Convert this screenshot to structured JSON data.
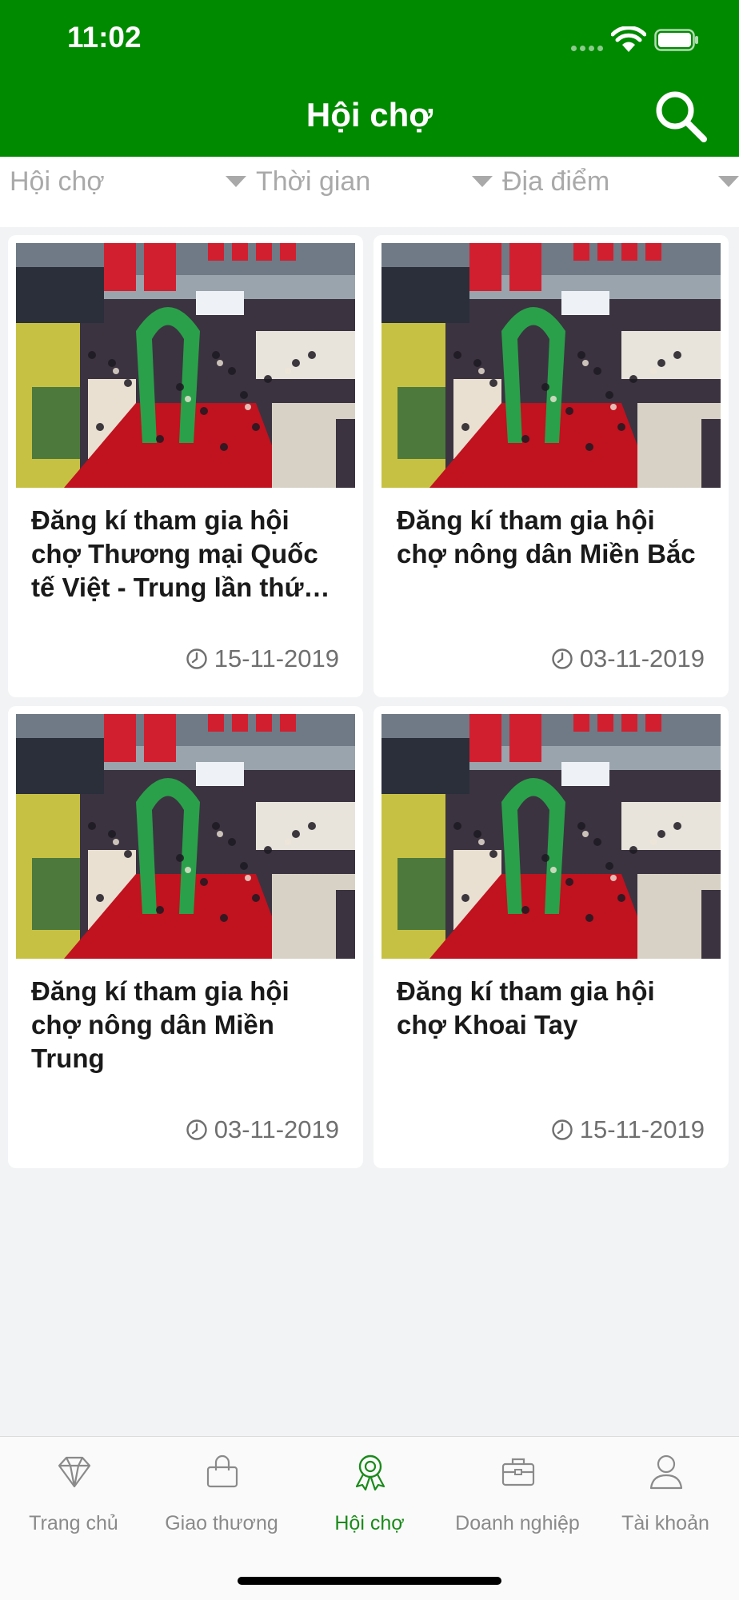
{
  "status": {
    "time": "11:02"
  },
  "header": {
    "title": "Hội chợ",
    "search_icon": "search-icon"
  },
  "filters": [
    {
      "label": "Hội chợ"
    },
    {
      "label": "Thời gian"
    },
    {
      "label": "Địa điểm"
    }
  ],
  "cards": [
    {
      "title": "Đăng kí tham gia hội chợ Thương mại Quốc tế Việt - Trung lần thứ…",
      "date": "15-11-2019"
    },
    {
      "title": "Đăng kí tham gia hội chợ nông dân Miền Bắc",
      "date": "03-11-2019"
    },
    {
      "title": "Đăng kí tham gia hội chợ nông dân Miền Trung",
      "date": "03-11-2019"
    },
    {
      "title": "Đăng kí tham gia hội chợ Khoai Tay",
      "date": "15-11-2019"
    }
  ],
  "tabs": [
    {
      "label": "Trang chủ",
      "icon": "diamond-icon"
    },
    {
      "label": "Giao thương",
      "icon": "shopping-bag-icon"
    },
    {
      "label": "Hội chợ",
      "icon": "award-ribbon-icon",
      "active": true
    },
    {
      "label": "Doanh nghiệp",
      "icon": "briefcase-icon"
    },
    {
      "label": "Tài khoản",
      "icon": "user-icon"
    }
  ],
  "colors": {
    "brand_green": "#008a00",
    "active_tab": "#1a8a1a",
    "inactive_tab": "#8a8a8a"
  }
}
